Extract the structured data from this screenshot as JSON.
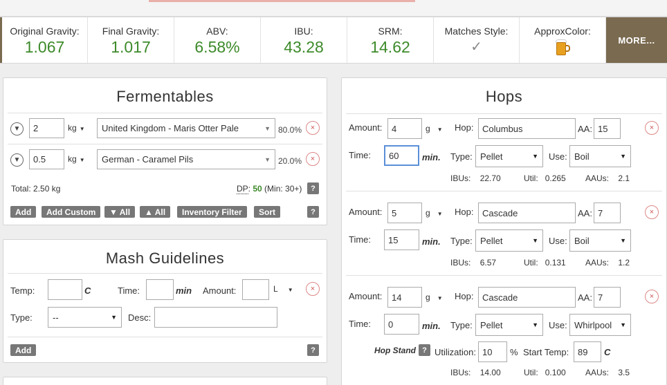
{
  "stats": [
    {
      "label": "Original Gravity:",
      "value": "1.067"
    },
    {
      "label": "Final Gravity:",
      "value": "1.017"
    },
    {
      "label": "ABV:",
      "value": "6.58%"
    },
    {
      "label": "IBU:",
      "value": "43.28"
    },
    {
      "label": "SRM:",
      "value": "14.62"
    },
    {
      "label": "Matches Style:",
      "value": "✓"
    },
    {
      "label": "ApproxColor:",
      "icon": "beer-mug-icon"
    }
  ],
  "more_label": "MORE...",
  "fermentables": {
    "title": "Fermentables",
    "rows": [
      {
        "amount": "2",
        "unit": "kg",
        "name": "United Kingdom - Maris Otter Pale",
        "percent": "80.0%"
      },
      {
        "amount": "0.5",
        "unit": "kg",
        "name": "German - Caramel Pils",
        "percent": "20.0%"
      }
    ],
    "total": "Total: 2.50 kg",
    "dp_label": "DP",
    "dp_value": "50",
    "dp_min": "(Min: 30+)",
    "buttons": {
      "add": "Add",
      "add_custom": "Add Custom",
      "collapse_all": "▼ All",
      "expand_all": "▲ All",
      "inventory_filter": "Inventory Filter",
      "sort": "Sort"
    },
    "help": "?"
  },
  "mash": {
    "title": "Mash Guidelines",
    "temp_label": "Temp:",
    "temp_unit": "C",
    "time_label": "Time:",
    "time_unit": "min",
    "amount_label": "Amount:",
    "amount_unit": "L",
    "type_label": "Type:",
    "type_value": "--",
    "desc_label": "Desc:",
    "add": "Add",
    "help": "?"
  },
  "hops": {
    "title": "Hops",
    "labels": {
      "amount": "Amount:",
      "hop": "Hop:",
      "aa": "AA:",
      "time": "Time:",
      "min": "min.",
      "type": "Type:",
      "use": "Use:",
      "ibus": "IBUs:",
      "util": "Util:",
      "aaus": "AAUs:"
    },
    "rows": [
      {
        "amount": "4",
        "unit": "g",
        "name": "Columbus",
        "aa": "15",
        "time": "60",
        "type": "Pellet",
        "use": "Boil",
        "ibus": "22.70",
        "util": "0.265",
        "aaus": "2.1"
      },
      {
        "amount": "5",
        "unit": "g",
        "name": "Cascade",
        "aa": "7",
        "time": "15",
        "type": "Pellet",
        "use": "Boil",
        "ibus": "6.57",
        "util": "0.131",
        "aaus": "1.2"
      },
      {
        "amount": "14",
        "unit": "g",
        "name": "Cascade",
        "aa": "7",
        "time": "0",
        "type": "Pellet",
        "use": "Whirlpool",
        "ibus": "14.00",
        "util": "0.100",
        "aaus": "3.5"
      }
    ],
    "hopstand": {
      "label": "Hop Stand",
      "help": "?",
      "util_label": "Utilization:",
      "util_value": "10",
      "util_unit": "%",
      "start_temp_label": "Start Temp:",
      "start_temp_value": "89",
      "start_temp_unit": "C"
    }
  },
  "colors": {
    "accent": "#7a6a50",
    "value_green": "#3d8a2a",
    "button_gray": "#777777"
  }
}
